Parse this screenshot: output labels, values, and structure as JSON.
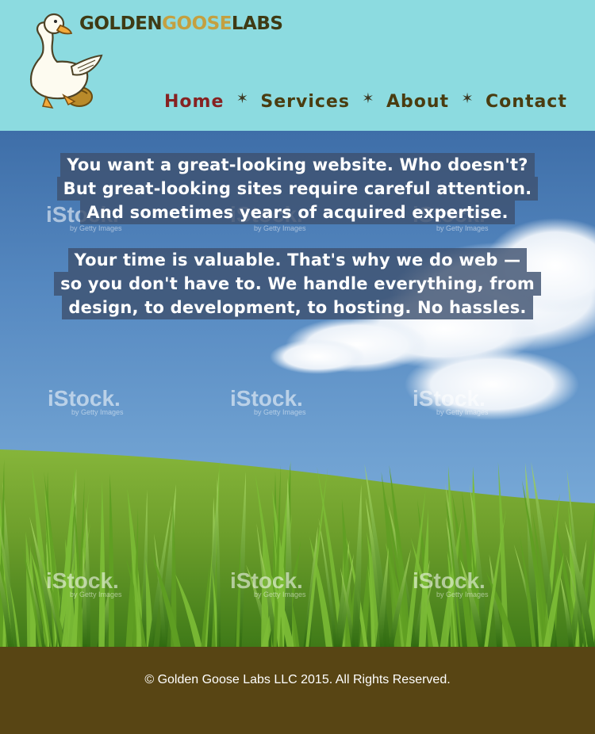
{
  "brand": {
    "part1": "GOLDEN",
    "part2": "GOOSE",
    "part3": "LABS",
    "colors": {
      "dark": "#3f3a14",
      "gold": "#c4a040"
    },
    "icon": "goose-with-golden-egg-icon"
  },
  "nav": {
    "items": [
      {
        "label": "Home",
        "active": true
      },
      {
        "label": "Services",
        "active": false
      },
      {
        "label": "About",
        "active": false
      },
      {
        "label": "Contact",
        "active": false
      }
    ],
    "separator_icon": "star-separator-icon",
    "active_color": "#862222",
    "text_color": "#4a3c10"
  },
  "hero": {
    "block1": [
      "You want a great-looking website. Who doesn't?",
      "But great-looking sites require careful attention.",
      "And sometimes years of acquired expertise."
    ],
    "block2": [
      "Your time is valuable. That's why we do web —",
      "so you don't have to. We handle everything, from",
      "design, to development, to hosting. No hassles."
    ],
    "watermark": {
      "text": "iStock.",
      "subtext": "by Getty Images"
    }
  },
  "footer": {
    "copyright": "© Golden Goose Labs LLC 2015. All Rights Reserved.",
    "background": "#584514"
  }
}
